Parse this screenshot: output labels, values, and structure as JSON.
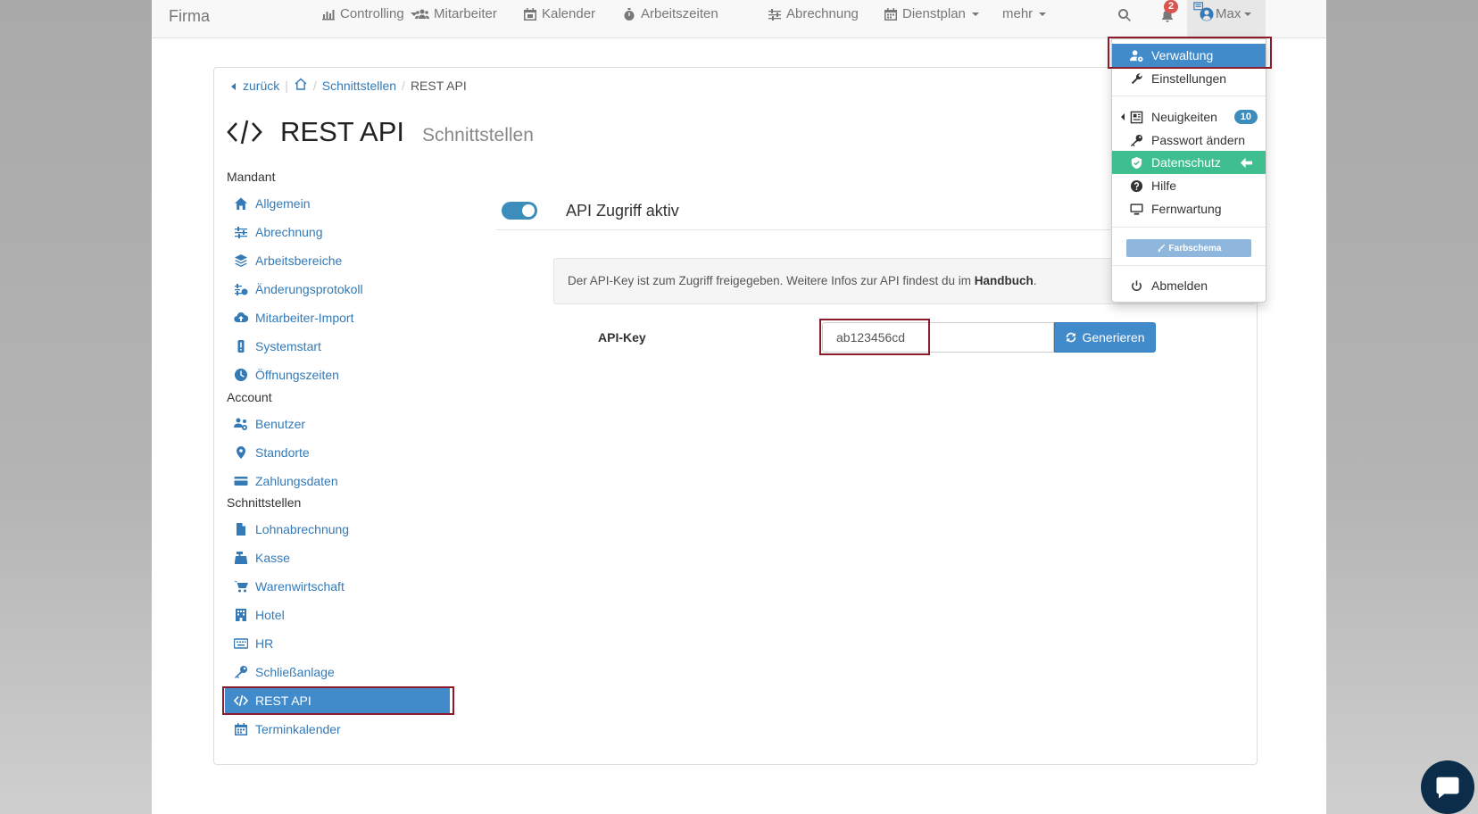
{
  "nav": {
    "brand": "Firma",
    "items": [
      {
        "label": "Controlling",
        "icon": "bar-chart-icon",
        "caret": true
      },
      {
        "label": "Mitarbeiter",
        "icon": "users-icon",
        "caret": false
      },
      {
        "label": "Kalender",
        "icon": "calendar-18-icon",
        "caret": false
      },
      {
        "label": "Arbeitszeiten",
        "icon": "stopwatch-icon",
        "caret": false
      },
      {
        "label": "Abrechnung",
        "icon": "sliders-icon",
        "caret": false
      },
      {
        "label": "Dienstplan",
        "icon": "calendar-grid-icon",
        "caret": true
      },
      {
        "label": "mehr",
        "icon": "",
        "caret": true
      }
    ],
    "notification_count": "2",
    "user": "Max"
  },
  "breadcrumb": {
    "back": "zurück",
    "sep": "/",
    "level1": "Schnittstellen",
    "current": "REST API"
  },
  "title": {
    "main": "REST API",
    "sub": "Schnittstellen"
  },
  "sidebar": {
    "groups": [
      {
        "heading": "Mandant",
        "items": [
          {
            "label": "Allgemein",
            "icon": "home-icon"
          },
          {
            "label": "Abrechnung",
            "icon": "sliders-icon"
          },
          {
            "label": "Arbeitsbereiche",
            "icon": "layers-icon"
          },
          {
            "label": "Änderungsprotokoll",
            "icon": "history-icon"
          },
          {
            "label": "Mitarbeiter-Import",
            "icon": "cloud-upload-icon"
          },
          {
            "label": "Systemstart",
            "icon": "exclamation-icon"
          },
          {
            "label": "Öffnungszeiten",
            "icon": "clock-icon"
          }
        ]
      },
      {
        "heading": "Account",
        "items": [
          {
            "label": "Benutzer",
            "icon": "users-cog-icon"
          },
          {
            "label": "Standorte",
            "icon": "map-marker-icon"
          },
          {
            "label": "Zahlungsdaten",
            "icon": "credit-card-icon"
          }
        ]
      },
      {
        "heading": "Schnittstellen",
        "items": [
          {
            "label": "Lohnabrechnung",
            "icon": "file-icon"
          },
          {
            "label": "Kasse",
            "icon": "cash-register-icon"
          },
          {
            "label": "Warenwirtschaft",
            "icon": "cart-icon"
          },
          {
            "label": "Hotel",
            "icon": "hotel-icon"
          },
          {
            "label": "HR",
            "icon": "keyboard-icon"
          },
          {
            "label": "Schließanlage",
            "icon": "key-icon"
          },
          {
            "label": "REST API",
            "icon": "code-icon"
          },
          {
            "label": "Terminkalender",
            "icon": "calendar-icon"
          }
        ]
      }
    ]
  },
  "main": {
    "api_active_label": "API Zugriff aktiv",
    "info_text": "Der API-Key ist zum Zugriff freigegeben. Weitere Infos zur API findest du im ",
    "info_link": "Handbuch",
    "info_end": ".",
    "api_key_label": "API-Key",
    "api_key_value": "ab123456cd",
    "generate_label": "Generieren"
  },
  "dropdown": {
    "verwaltung": "Verwaltung",
    "einstellungen": "Einstellungen",
    "neuigkeiten": "Neuigkeiten",
    "neuigkeiten_badge": "10",
    "passwort": "Passwort ändern",
    "datenschutz": "Datenschutz",
    "hilfe": "Hilfe",
    "fernwartung": "Fernwartung",
    "farbschema": "Farbschema",
    "abmelden": "Abmelden"
  },
  "colors": {
    "primary": "#428bca",
    "link": "#337ab7",
    "success": "#3fbf8f",
    "highlight": "#8b1a2b"
  }
}
